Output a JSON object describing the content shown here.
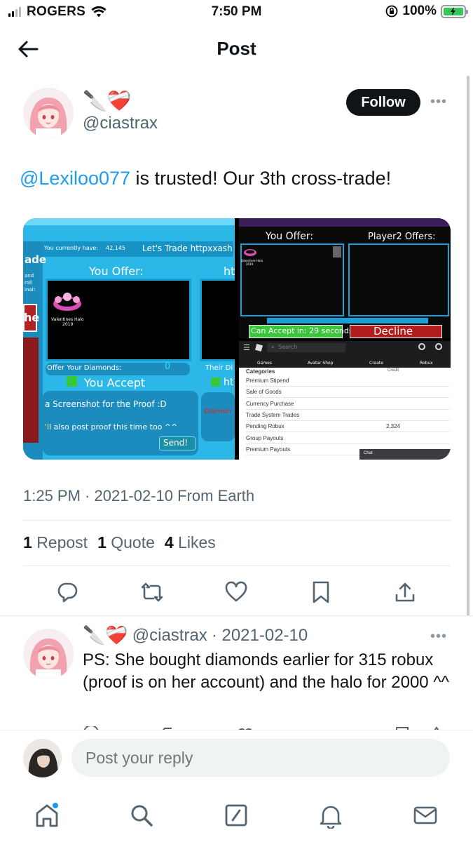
{
  "status_bar": {
    "carrier": "ROGERS",
    "time": "7:50 PM",
    "battery": "100%"
  },
  "header": {
    "title": "Post"
  },
  "post": {
    "author_emoji": "🔪❤️‍🩹",
    "handle": "@ciastrax",
    "follow_label": "Follow",
    "mention": "@Lexiloo077",
    "text": " is trusted! Our 3th cross-trade!",
    "timestamp": "1:25 PM · 2021-02-10 From Earth",
    "stats": {
      "reposts_count": "1",
      "reposts_label": "Repost",
      "quotes_count": "1",
      "quotes_label": "Quote",
      "likes_count": "4",
      "likes_label": "Likes"
    }
  },
  "media": {
    "img1": {
      "currently_have": "You currently have:",
      "currently_value": "42,145",
      "lets_trade": "Let's Trade httpxxash",
      "ade": "ade",
      "side1": "and",
      "side2": "roll",
      "side3": "inal!",
      "side_he": "he",
      "you_offer": "You Offer:",
      "ht": "ht",
      "item_name": "Valentines Halo",
      "item_year": "2019",
      "offer_diamonds": "Offer Your Diamonds:",
      "diamond_value": "0",
      "their_di": "Their Di",
      "you_accept": "You Accept",
      "ht2": "ht",
      "screenshot": "a Screenshot for the Proof :D",
      "also_post": "'ll also post proof this time too ^^",
      "send": "Send!",
      "diamon": "Diamon"
    },
    "img2": {
      "you_offer": "You Offer:",
      "player2_offers": "Player2 Offers:",
      "item_name": "Valentines Halo",
      "item_year": "2019",
      "can_accept": "Can Accept in: 29 seconds",
      "decline": "Decline"
    },
    "img3": {
      "search_placeholder": "Search",
      "nav": [
        "Games",
        "Avatar Shop",
        "Create",
        "Robux"
      ],
      "header_categories": "Categories",
      "header_credit": "Credit",
      "rows": [
        {
          "label": "Premium Stipend",
          "value": ""
        },
        {
          "label": "Sale of Goods",
          "value": ""
        },
        {
          "label": "Currency Purchase",
          "value": ""
        },
        {
          "label": "Trade System Trades",
          "value": ""
        },
        {
          "label": "Pending Robux",
          "value": "2,324"
        },
        {
          "label": "Group Payouts",
          "value": ""
        },
        {
          "label": "Premium Payouts",
          "value": ""
        }
      ],
      "chat": "Chat"
    }
  },
  "reply": {
    "author_emoji": "🔪❤️‍🩹",
    "handle": "@ciastrax",
    "date": "· 2021-02-10",
    "text": "PS: She bought diamonds earlier for 315 robux (proof is on her account) and the halo for 2000 ^^"
  },
  "composer": {
    "placeholder": "Post your reply"
  },
  "icons": {
    "back": "arrow-left-icon",
    "more": "more-icon",
    "reply": "reply-icon",
    "repost": "repost-icon",
    "like": "heart-icon",
    "bookmark": "bookmark-icon",
    "share": "share-icon",
    "home": "home-icon",
    "search": "search-icon",
    "compose": "compose-icon",
    "notifications": "bell-icon",
    "messages": "mail-icon"
  }
}
